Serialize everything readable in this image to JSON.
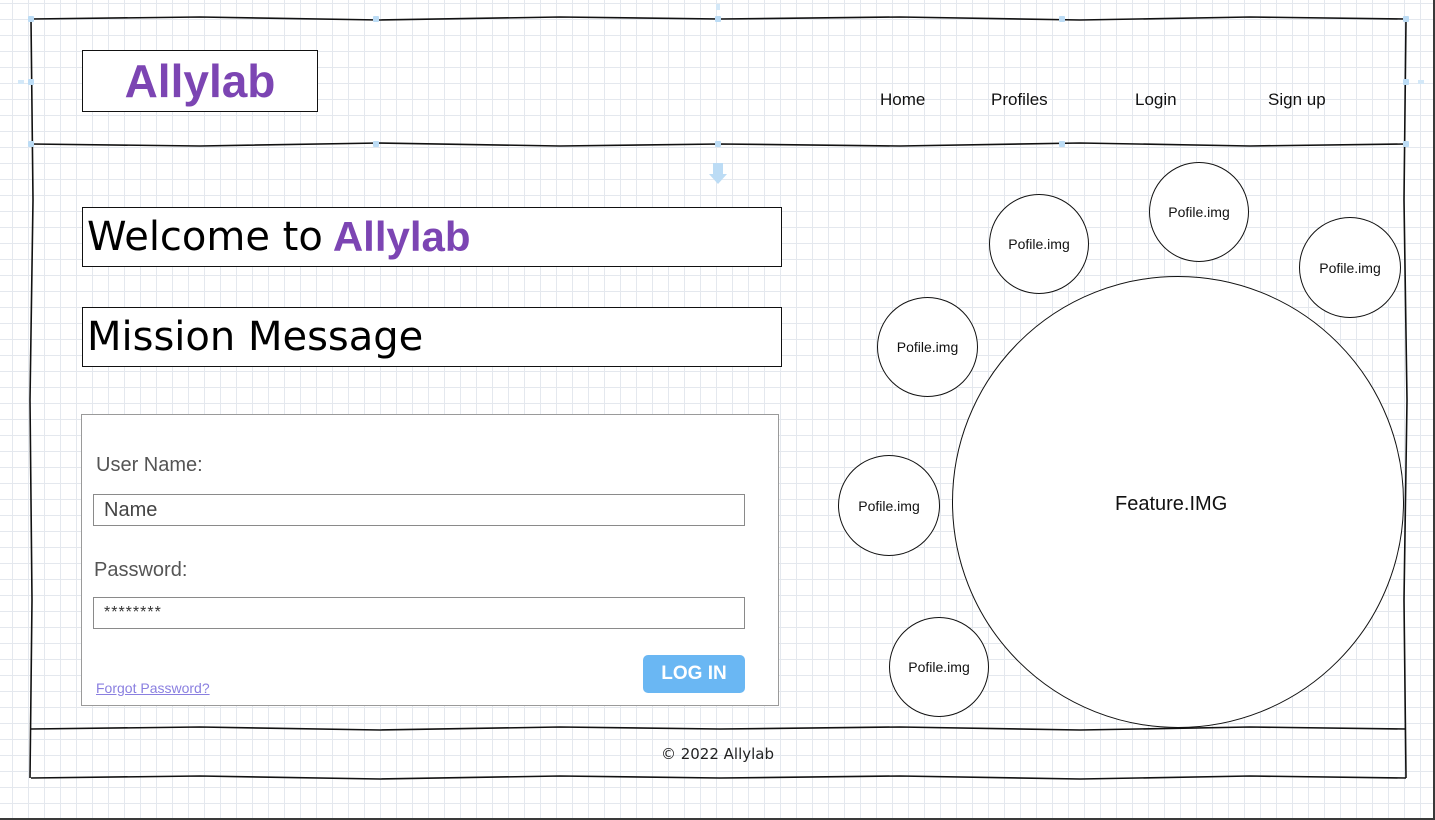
{
  "header": {
    "logo_text": "Allylab",
    "nav": [
      "Home",
      "Profiles",
      "Login",
      "Sign up"
    ]
  },
  "hero": {
    "welcome_prefix": "Welcome to",
    "welcome_brand": "Allylab",
    "mission": "Mission Message"
  },
  "login_form": {
    "username_label": "User Name:",
    "username_placeholder": "Name",
    "password_label": "Password:",
    "password_value": "********",
    "forgot_link": "Forgot Password?",
    "submit_label": "LOG IN"
  },
  "profiles": [
    "Pofile.img",
    "Pofile.img",
    "Pofile.img",
    "Pofile.img",
    "Pofile.img",
    "Pofile.img"
  ],
  "feature_label": "Feature.IMG",
  "footer": {
    "copyright": "© 2022 Allylab"
  },
  "colors": {
    "brand_purple": "#7c45b3",
    "button_blue": "#6ab7f3",
    "link_purple": "#8a7fe0",
    "grid_line": "#e4e8ee"
  }
}
